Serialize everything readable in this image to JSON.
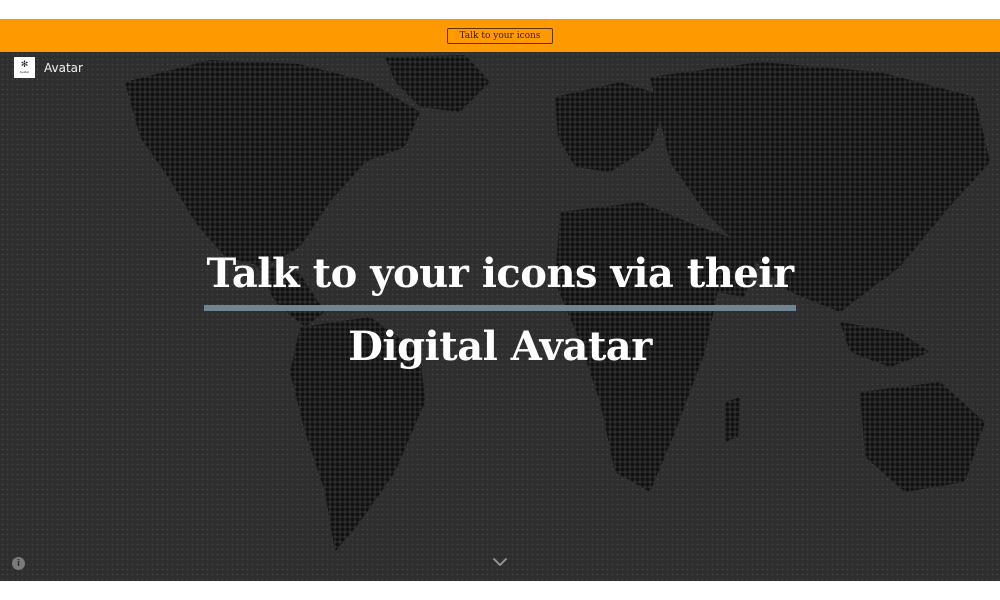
{
  "topbar": {
    "cta_label": "Talk to your icons",
    "background": "#ff9900"
  },
  "brand": {
    "name": "Avatar",
    "logo_icon": "avatar-logo-icon",
    "logo_caption": "Avatar"
  },
  "hero": {
    "headline_line1": "Talk to your icons via their",
    "headline_line2": "Digital Avatar",
    "background": "#2e2e2e",
    "rule_color": "#6e8592",
    "pattern": "dotted-world-map"
  },
  "controls": {
    "info_glyph": "i",
    "info_icon": "info-icon",
    "scroll_icon": "chevron-down-icon"
  }
}
